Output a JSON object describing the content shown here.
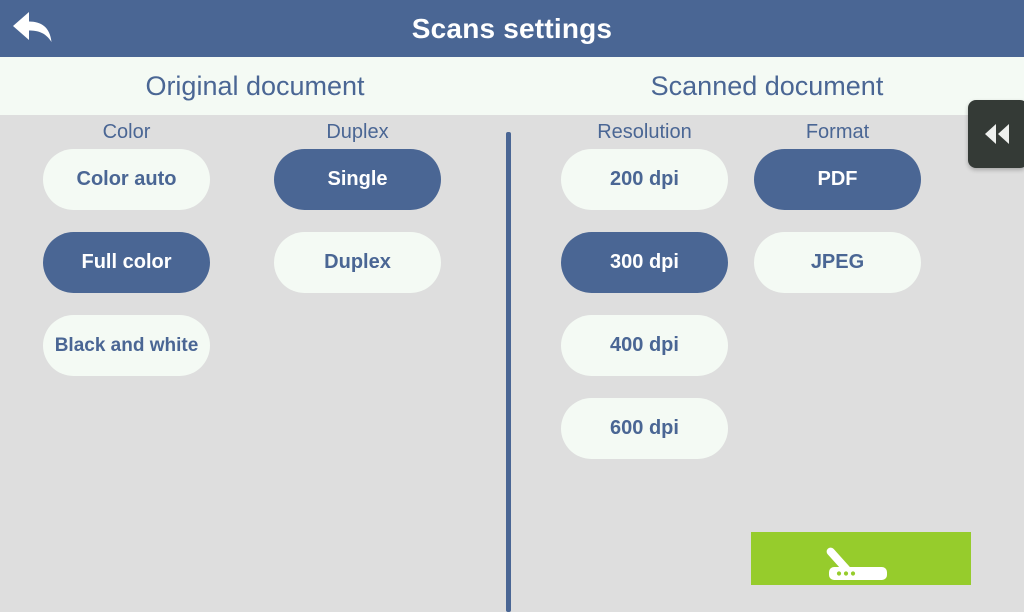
{
  "header": {
    "title": "Scans settings",
    "back_icon": "back-arrow-icon"
  },
  "sections": {
    "left_title": "Original document",
    "right_title": "Scanned document"
  },
  "groups": [
    {
      "key": "color",
      "title": "Color",
      "options": [
        {
          "label": "Color auto",
          "selected": false
        },
        {
          "label": "Full color",
          "selected": true
        },
        {
          "label": "Black and white",
          "selected": false
        }
      ]
    },
    {
      "key": "duplex",
      "title": "Duplex",
      "options": [
        {
          "label": "Single",
          "selected": true
        },
        {
          "label": "Duplex",
          "selected": false
        }
      ]
    },
    {
      "key": "resolution",
      "title": "Resolution",
      "options": [
        {
          "label": "200 dpi",
          "selected": false
        },
        {
          "label": "300 dpi",
          "selected": true
        },
        {
          "label": "400 dpi",
          "selected": false
        },
        {
          "label": "600 dpi",
          "selected": false
        }
      ]
    },
    {
      "key": "format",
      "title": "Format",
      "options": [
        {
          "label": "PDF",
          "selected": true
        },
        {
          "label": "JPEG",
          "selected": false
        }
      ]
    }
  ],
  "actions": {
    "scan_icon": "scanner-icon",
    "collapse_icon": "double-chevron-left-icon"
  },
  "colors": {
    "brand_blue": "#4a6694",
    "panel_bg": "#dedede",
    "band_bg": "#f4faf4",
    "pill_off_bg": "#f4faf4",
    "scan_green": "#96cc2c",
    "tab_dark": "#343a36"
  }
}
